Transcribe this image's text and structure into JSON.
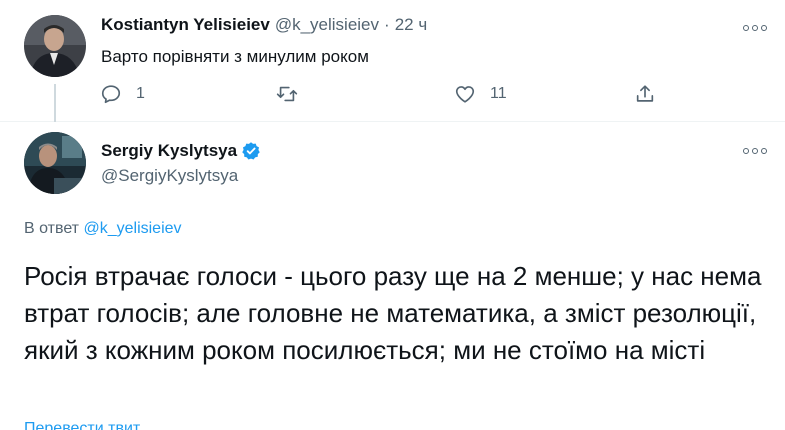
{
  "tweet1": {
    "author_name": "Kostiantyn Yelisieiev",
    "handle": "@k_yelisieiev",
    "separator": "·",
    "time": "22 ч",
    "text": "Варто порівняти з минулим роком",
    "reply_count": "1",
    "retweet_count": "",
    "like_count": "11"
  },
  "tweet2": {
    "author_name": "Sergiy Kyslytsya",
    "handle": "@SergiyKyslytsya",
    "verified": true,
    "reply_prefix": "В ответ",
    "reply_mention": "@k_yelisieiev",
    "text": "Росія втрачає голоси - цього разу ще на 2 менше; у нас нема втрат голосів; але головне не математика, а зміст резолюції, який з кожним роком посилюється; ми не стоїмо на місті",
    "translate_link": "Перевести твит"
  },
  "icons": [
    "more-icon",
    "reply-icon",
    "retweet-icon",
    "like-icon",
    "share-icon",
    "verified-icon"
  ],
  "colors": {
    "accent": "#1d9bf0",
    "text": "#0f1419",
    "muted": "#536471",
    "divider": "#eff3f4"
  }
}
